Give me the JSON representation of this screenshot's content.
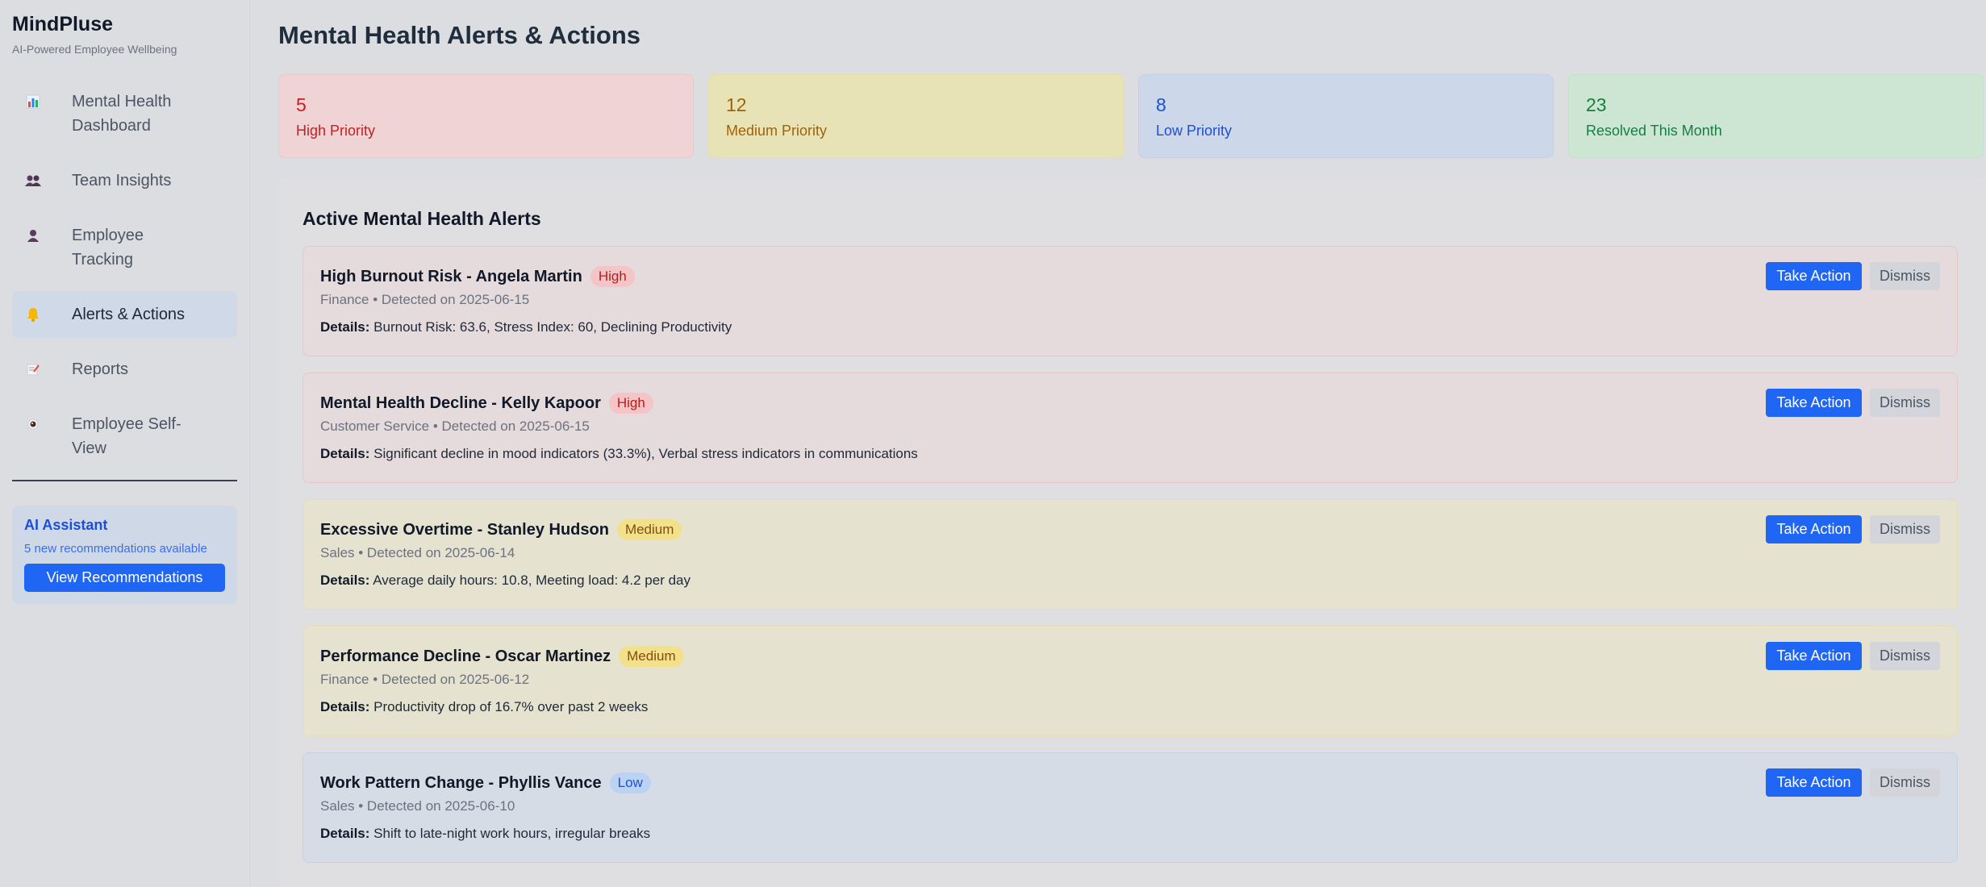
{
  "sidebar": {
    "brand_name": "MindPluse",
    "brand_tagline": "AI-Powered Employee Wellbeing",
    "nav": [
      {
        "label": "Mental Health Dashboard",
        "icon": "bar-chart-icon"
      },
      {
        "label": "Team Insights",
        "icon": "users-icon"
      },
      {
        "label": "Employee Tracking",
        "icon": "user-icon"
      },
      {
        "label": "Alerts & Actions",
        "icon": "bell-icon",
        "active": true
      },
      {
        "label": "Reports",
        "icon": "memo-icon"
      },
      {
        "label": "Employee Self-View",
        "icon": "eye-icon"
      }
    ],
    "ai_assistant": {
      "title": "AI Assistant",
      "subtitle": "5 new recommendations available",
      "button": "View Recommendations"
    }
  },
  "page": {
    "title": "Mental Health Alerts & Actions"
  },
  "stats": [
    {
      "value": "5",
      "label": "High Priority",
      "color": "#c81e1e"
    },
    {
      "value": "12",
      "label": "Medium Priority",
      "color": "#a16207"
    },
    {
      "value": "8",
      "label": "Low Priority",
      "color": "#1d4ed8"
    },
    {
      "value": "23",
      "label": "Resolved This Month",
      "color": "#15803d"
    }
  ],
  "alerts_panel": {
    "title": "Active Mental Health Alerts",
    "take_action_label": "Take Action",
    "dismiss_label": "Dismiss",
    "details_label": "Details:",
    "alerts": [
      {
        "title": "High Burnout Risk - Angela Martin",
        "priority": "High",
        "meta": "Finance • Detected on 2025-06-15",
        "details": "Burnout Risk: 63.6, Stress Index: 60, Declining Productivity"
      },
      {
        "title": "Mental Health Decline - Kelly Kapoor",
        "priority": "High",
        "meta": "Customer Service • Detected on 2025-06-15",
        "details": "Significant decline in mood indicators (33.3%), Verbal stress indicators in communications"
      },
      {
        "title": "Excessive Overtime - Stanley Hudson",
        "priority": "Medium",
        "meta": "Sales • Detected on 2025-06-14",
        "details": "Average daily hours: 10.8, Meeting load: 4.2 per day"
      },
      {
        "title": "Performance Decline - Oscar Martinez",
        "priority": "Medium",
        "meta": "Finance • Detected on 2025-06-12",
        "details": "Productivity drop of 16.7% over past 2 weeks"
      },
      {
        "title": "Work Pattern Change - Phyllis Vance",
        "priority": "Low",
        "meta": "Sales • Detected on 2025-06-10",
        "details": "Shift to late-night work hours, irregular breaks"
      }
    ]
  }
}
